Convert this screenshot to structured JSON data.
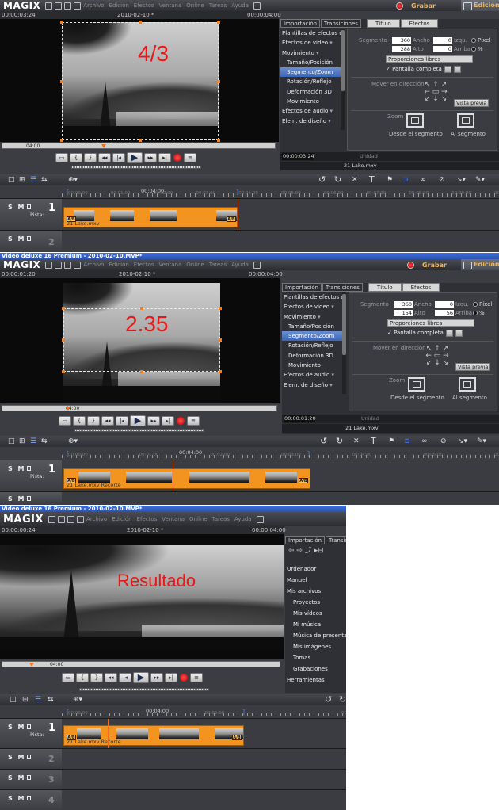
{
  "panels": [
    {
      "window_title": "",
      "app": {
        "logo": "MAGIX",
        "menu": [
          "Archivo",
          "Edición",
          "Efectos",
          "Ventana",
          "Online",
          "Tareas",
          "Ayuda"
        ],
        "grabar": "Grabar",
        "edicion": "Edición"
      },
      "timecodes": {
        "position": "00:00:03:24",
        "project": "2010-02-10 *",
        "duration": "00:00:04:00"
      },
      "overlay_label": "4/3",
      "scrub_label": "04:00",
      "tabs": [
        "Importación",
        "Transiciones",
        "Título",
        "Efectos"
      ],
      "nav": [
        "Plantillas de efectos de",
        "Efectos de vídeo",
        "Movimiento",
        "Tamaño/Posición",
        "Segmento/Zoom",
        "Rotación/Reflejo",
        "Deformación 3D",
        "Movimiento",
        "Efectos de audio",
        "Elem. de diseño"
      ],
      "nav_selected": 4,
      "fx": {
        "segmento": "Segmento",
        "v1": "360",
        "l1": "Ancho",
        "v2": "0",
        "l2": "Izqu.",
        "unit1": "Píxel",
        "v3": "288",
        "l3": "Alto",
        "v4": "0",
        "l4": "Arriba",
        "unit2": "%",
        "proporciones": "Proporciones libres",
        "pantalla": "Pantalla completa",
        "mover": "Mover en dirección",
        "vista": "Vista previa",
        "zoom": "Zoom",
        "desde": "Desde el segmento",
        "al": "Al segmento"
      },
      "rp_tc": "00:00:03:24",
      "rp_unidad": "Unidad",
      "clip_name": "21 Lake.mxv",
      "ruler_time": "00:04:00",
      "ruler_marks": [
        "00:00:00",
        "00:01:00",
        "00:02:00",
        "00:03:00",
        "00:04:00",
        "00:05:00",
        "00:06:00",
        "00:07:00",
        "00:08:00",
        "00:09:00",
        "00:10:00"
      ],
      "track": {
        "sm": "S M",
        "num": "1",
        "pista": "Pista:",
        "num2": "2"
      },
      "clip_label": "21 Lake.mxv",
      "ab": "A/B"
    },
    {
      "window_title": "Video deluxe 16 Premium - 2010-02-10.MVP*",
      "app": {
        "logo": "MAGIX",
        "menu": [
          "Archivo",
          "Edición",
          "Efectos",
          "Ventana",
          "Online",
          "Tareas",
          "Ayuda"
        ],
        "grabar": "Grabar",
        "edicion": "Edición"
      },
      "timecodes": {
        "position": "00:00:01:20",
        "project": "2010-02-10 *",
        "duration": "00:00:04:00"
      },
      "overlay_label": "2.35",
      "scrub_label": "04:00",
      "tabs": [
        "Importación",
        "Transiciones",
        "Título",
        "Efectos"
      ],
      "nav": [
        "Plantillas de efectos de",
        "Efectos de vídeo",
        "Movimiento",
        "Tamaño/Posición",
        "Segmento/Zoom",
        "Rotación/Reflejo",
        "Deformación 3D",
        "Movimiento",
        "Efectos de audio",
        "Elem. de diseño"
      ],
      "nav_selected": 4,
      "fx": {
        "segmento": "Segmento",
        "v1": "360",
        "l1": "Ancho",
        "v2": "0",
        "l2": "Izqu.",
        "unit1": "Píxel",
        "v3": "154",
        "l3": "Alto",
        "v4": "56",
        "l4": "Arriba",
        "unit2": "%",
        "proporciones": "Proporciones libres",
        "pantalla": "Pantalla completa",
        "mover": "Mover en dirección",
        "vista": "Vista previa",
        "zoom": "Zoom",
        "desde": "Desde el segmento",
        "al": "Al segmento"
      },
      "rp_tc": "00:00:01:20",
      "rp_unidad": "Unidad",
      "clip_name": "21 Lake.mxv",
      "ruler_time": "00:04:00",
      "ruler_marks": [
        "00:00:00",
        "00:01:00",
        "00:02:00",
        "00:03:00",
        "00:04:00",
        "00:05:00",
        "00:06:00"
      ],
      "track": {
        "sm": "S M",
        "num": "1",
        "pista": "Pista:",
        "num2": ""
      },
      "clip_label": "21 Lake.mxv  Recorte",
      "ab": "A/B"
    },
    {
      "window_title": "Video deluxe 16 Premium - 2010-02-10.MVP*",
      "app": {
        "logo": "MAGIX",
        "menu": [
          "Archivo",
          "Edición",
          "Efectos",
          "Ventana",
          "Online",
          "Tareas",
          "Ayuda"
        ]
      },
      "timecodes": {
        "position": "00:00:00:24",
        "project": "2010-02-10 *",
        "duration": "00:00:04:00"
      },
      "overlay_label": "Resultado",
      "scrub_label": "04:00",
      "tabs": [
        "Importación",
        "Transiciones"
      ],
      "media_items": [
        "Ordenador",
        "Manuel",
        "Mis archivos",
        "Proyectos",
        "Mis vídeos",
        "Mi música",
        "Música de presenta",
        "Mis imágenes",
        "Tomas",
        "Grabaciones",
        "Herramientas"
      ],
      "ruler_time": "00:04:00",
      "ruler_marks": [
        "00:00:00",
        "00:02:00",
        "00:04:00"
      ],
      "track": {
        "sm": "S M",
        "num": "1",
        "pista": "Pista:",
        "num2": "2",
        "num3": "3",
        "num4": "4"
      },
      "clip_label": "21 Lake.mxv  Recorte",
      "ab": "A/B"
    }
  ]
}
